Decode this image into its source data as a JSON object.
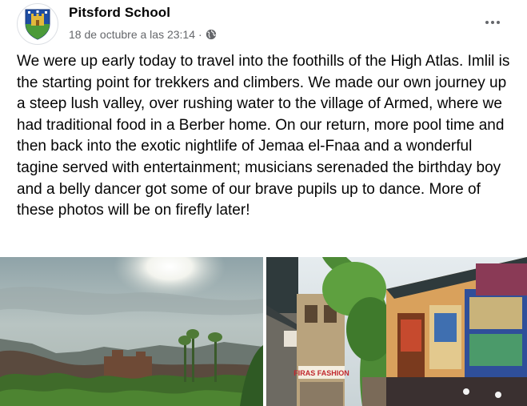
{
  "post": {
    "page_name": "Pitsford School",
    "timestamp": "18 de octubre a las 23:14",
    "separator": "·",
    "audience_icon": "globe-icon",
    "more_icon": "more-options-icon",
    "body": "We were up early today to travel into the foothills of the High Atlas. Imlil is the starting point for trekkers and climbers. We made our own journey up a steep lush valley, over rushing water to the village of Armed, where we had traditional food in a Berber home. On our return, more pool time and then back into the exotic nightlife of Jemaa el-Fnaa and a wonderful tagine served with entertainment; musicians serenaded the birthday boy and a belly dancer got some of our brave pupils up to dance. More of these photos will be on firefly later!"
  },
  "photos": {
    "shop_sign_text": "FIRAS FASHION"
  },
  "colors": {
    "text_primary": "#050505",
    "text_secondary": "#65676b",
    "crest_blue": "#1f4ea3",
    "crest_green": "#4b9a3a",
    "crest_gold": "#e2b93b"
  }
}
